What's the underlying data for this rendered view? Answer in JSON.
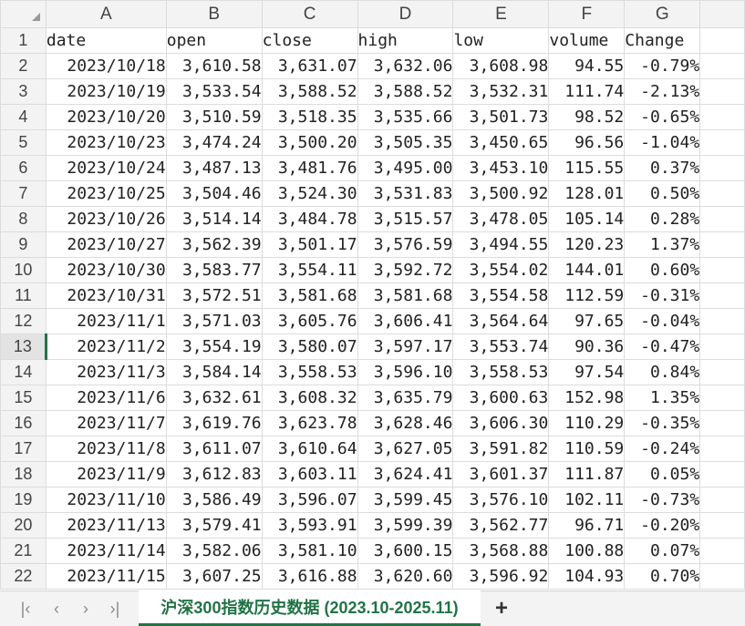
{
  "columns": [
    "A",
    "B",
    "C",
    "D",
    "E",
    "F",
    "G"
  ],
  "rows": [
    {
      "n": "1",
      "cells": [
        "date",
        "open",
        "close",
        "high",
        "low",
        "volume",
        "Change"
      ]
    },
    {
      "n": "2",
      "cells": [
        "2023/10/18",
        "3,610.58",
        "3,631.07",
        "3,632.06",
        "3,608.98",
        "94.55",
        "-0.79%"
      ]
    },
    {
      "n": "3",
      "cells": [
        "2023/10/19",
        "3,533.54",
        "3,588.52",
        "3,588.52",
        "3,532.31",
        "111.74",
        "-2.13%"
      ]
    },
    {
      "n": "4",
      "cells": [
        "2023/10/20",
        "3,510.59",
        "3,518.35",
        "3,535.66",
        "3,501.73",
        "98.52",
        "-0.65%"
      ]
    },
    {
      "n": "5",
      "cells": [
        "2023/10/23",
        "3,474.24",
        "3,500.20",
        "3,505.35",
        "3,450.65",
        "96.56",
        "-1.04%"
      ]
    },
    {
      "n": "6",
      "cells": [
        "2023/10/24",
        "3,487.13",
        "3,481.76",
        "3,495.00",
        "3,453.10",
        "115.55",
        "0.37%"
      ]
    },
    {
      "n": "7",
      "cells": [
        "2023/10/25",
        "3,504.46",
        "3,524.30",
        "3,531.83",
        "3,500.92",
        "128.01",
        "0.50%"
      ]
    },
    {
      "n": "8",
      "cells": [
        "2023/10/26",
        "3,514.14",
        "3,484.78",
        "3,515.57",
        "3,478.05",
        "105.14",
        "0.28%"
      ]
    },
    {
      "n": "9",
      "cells": [
        "2023/10/27",
        "3,562.39",
        "3,501.17",
        "3,576.59",
        "3,494.55",
        "120.23",
        "1.37%"
      ]
    },
    {
      "n": "10",
      "cells": [
        "2023/10/30",
        "3,583.77",
        "3,554.11",
        "3,592.72",
        "3,554.02",
        "144.01",
        "0.60%"
      ]
    },
    {
      "n": "11",
      "cells": [
        "2023/10/31",
        "3,572.51",
        "3,581.68",
        "3,581.68",
        "3,554.58",
        "112.59",
        "-0.31%"
      ]
    },
    {
      "n": "12",
      "cells": [
        "2023/11/1",
        "3,571.03",
        "3,605.76",
        "3,606.41",
        "3,564.64",
        "97.65",
        "-0.04%"
      ]
    },
    {
      "n": "13",
      "cells": [
        "2023/11/2",
        "3,554.19",
        "3,580.07",
        "3,597.17",
        "3,553.74",
        "90.36",
        "-0.47%"
      ]
    },
    {
      "n": "14",
      "cells": [
        "2023/11/3",
        "3,584.14",
        "3,558.53",
        "3,596.10",
        "3,558.53",
        "97.54",
        "0.84%"
      ]
    },
    {
      "n": "15",
      "cells": [
        "2023/11/6",
        "3,632.61",
        "3,608.32",
        "3,635.79",
        "3,600.63",
        "152.98",
        "1.35%"
      ]
    },
    {
      "n": "16",
      "cells": [
        "2023/11/7",
        "3,619.76",
        "3,623.78",
        "3,628.46",
        "3,606.30",
        "110.29",
        "-0.35%"
      ]
    },
    {
      "n": "17",
      "cells": [
        "2023/11/8",
        "3,611.07",
        "3,610.64",
        "3,627.05",
        "3,591.82",
        "110.59",
        "-0.24%"
      ]
    },
    {
      "n": "18",
      "cells": [
        "2023/11/9",
        "3,612.83",
        "3,603.11",
        "3,624.41",
        "3,601.37",
        "111.87",
        "0.05%"
      ]
    },
    {
      "n": "19",
      "cells": [
        "2023/11/10",
        "3,586.49",
        "3,596.07",
        "3,599.45",
        "3,576.10",
        "102.11",
        "-0.73%"
      ]
    },
    {
      "n": "20",
      "cells": [
        "2023/11/13",
        "3,579.41",
        "3,593.91",
        "3,599.39",
        "3,562.77",
        "96.71",
        "-0.20%"
      ]
    },
    {
      "n": "21",
      "cells": [
        "2023/11/14",
        "3,582.06",
        "3,581.10",
        "3,600.15",
        "3,568.88",
        "100.88",
        "0.07%"
      ]
    },
    {
      "n": "22",
      "cells": [
        "2023/11/15",
        "3,607.25",
        "3,616.88",
        "3,620.60",
        "3,596.92",
        "104.93",
        "0.70%"
      ]
    }
  ],
  "active_row": "13",
  "tabbar": {
    "first_icon": "first-sheet-icon",
    "prev_icon": "prev-sheet-icon",
    "next_icon": "next-sheet-icon",
    "last_icon": "last-sheet-icon",
    "sheet_name": "沪深300指数历史数据 (2023.10-2025.11)",
    "add_icon": "plus-icon"
  },
  "colors": {
    "accent": "#217346",
    "header_bg": "#f3f3f3",
    "grid": "#dcdcdc"
  }
}
